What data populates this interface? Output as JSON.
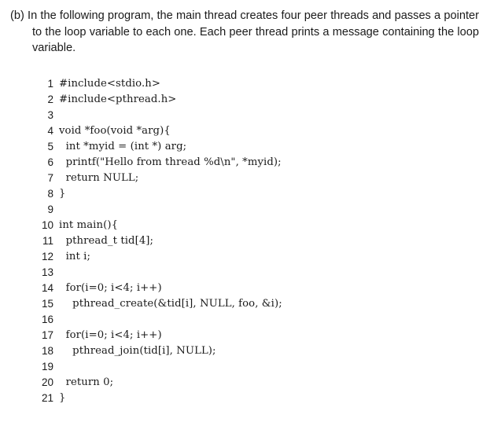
{
  "problem": {
    "marker": "(b)",
    "text": "In the following program, the main thread creates four peer threads and passes a pointer to the loop variable to each one. Each peer thread prints a message containing the loop variable."
  },
  "code": [
    {
      "n": "1",
      "code": "#include<stdio.h>"
    },
    {
      "n": "2",
      "code": "#include<pthread.h>"
    },
    {
      "n": "3",
      "code": ""
    },
    {
      "n": "4",
      "code": "void *foo(void *arg){"
    },
    {
      "n": "5",
      "code": "  int *myid = (int *) arg;"
    },
    {
      "n": "6",
      "code": "  printf(\"Hello from thread %d\\n\", *myid);"
    },
    {
      "n": "7",
      "code": "  return NULL;"
    },
    {
      "n": "8",
      "code": "}"
    },
    {
      "n": "9",
      "code": ""
    },
    {
      "n": "10",
      "code": "int main(){"
    },
    {
      "n": "11",
      "code": "  pthread_t tid[4];"
    },
    {
      "n": "12",
      "code": "  int i;"
    },
    {
      "n": "13",
      "code": ""
    },
    {
      "n": "14",
      "code": "  for(i=0; i<4; i++)"
    },
    {
      "n": "15",
      "code": "    pthread_create(&tid[i], NULL, foo, &i);"
    },
    {
      "n": "16",
      "code": ""
    },
    {
      "n": "17",
      "code": "  for(i=0; i<4; i++)"
    },
    {
      "n": "18",
      "code": "    pthread_join(tid[i], NULL);"
    },
    {
      "n": "19",
      "code": ""
    },
    {
      "n": "20",
      "code": "  return 0;"
    },
    {
      "n": "21",
      "code": "}"
    }
  ]
}
